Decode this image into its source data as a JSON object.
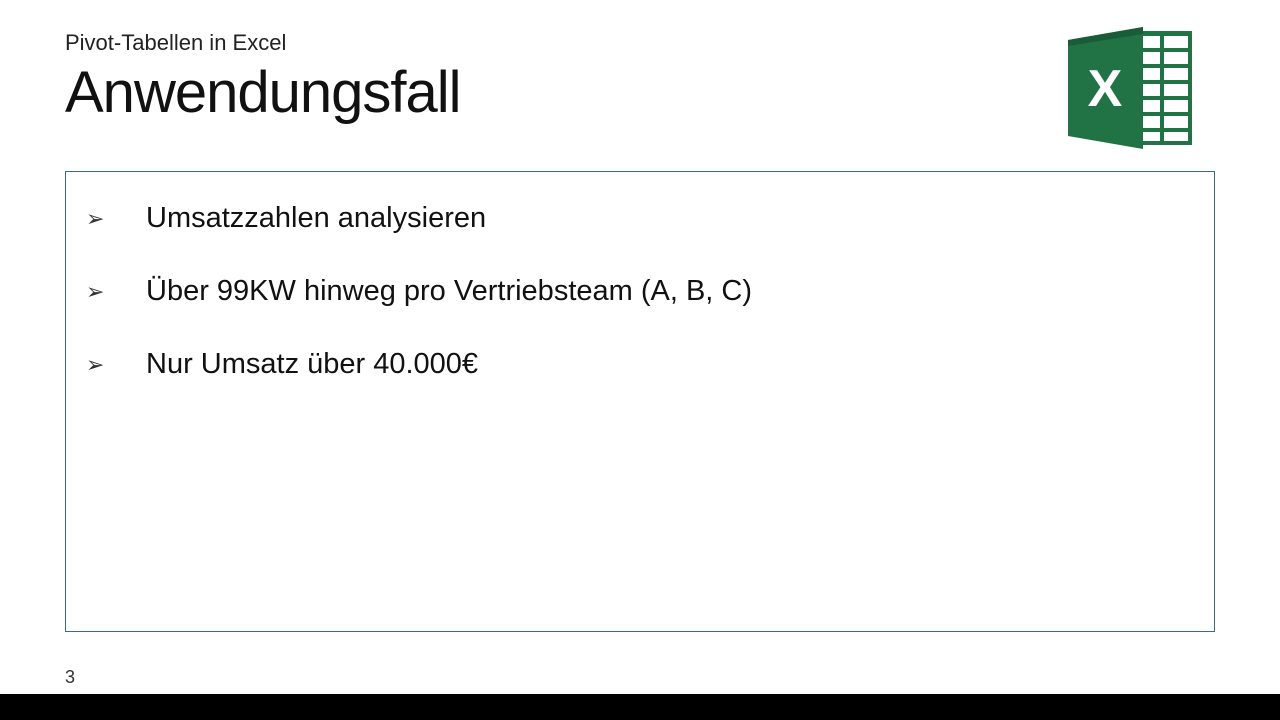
{
  "subtitle": "Pivot-Tabellen in Excel",
  "title": "Anwendungsfall",
  "bullets": [
    "Umsatzzahlen analysieren",
    "Über 99KW hinweg pro Vertriebsteam (A, B, C)",
    "Nur Umsatz über 40.000€"
  ],
  "page_number": "3",
  "icon": {
    "primary": "#217346",
    "secondary": "#1a5c38",
    "light": "#2d8a55"
  }
}
